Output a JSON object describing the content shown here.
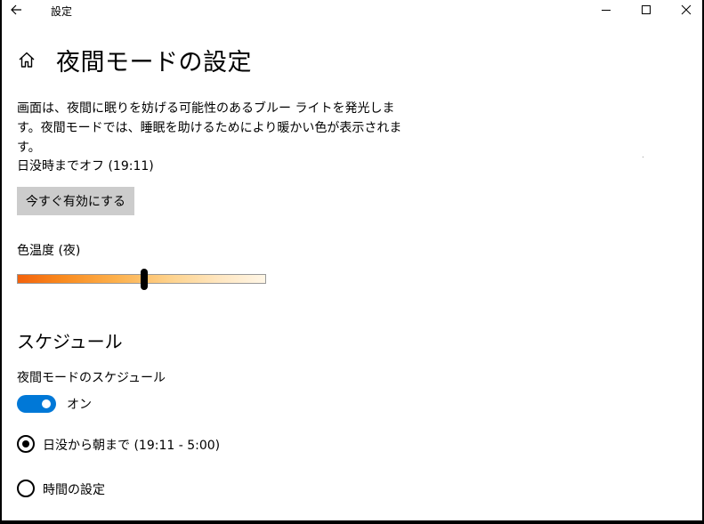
{
  "window": {
    "title": "設定",
    "controls": {
      "minimize": "minimize-icon",
      "maximize": "maximize-icon",
      "close": "close-icon"
    }
  },
  "header": {
    "back_icon": "back-arrow-icon",
    "home_icon": "home-icon",
    "title": "夜間モードの設定"
  },
  "description": "画面は、夜間に眠りを妨げる可能性のあるブルー ライトを発光します。夜間モードでは、睡眠を助けるためにより暖かい色が表示されます。",
  "status": "日没時までオフ (19:11)",
  "enable_button": "今すぐ有効にする",
  "color_temperature": {
    "label": "色温度 (夜)",
    "value_fraction": 0.51
  },
  "schedule": {
    "heading": "スケジュール",
    "toggle_label": "夜間モードのスケジュール",
    "toggle_state": "オン",
    "toggle_on": true,
    "options": [
      {
        "label": "日没から朝まで (19:11 - 5:00)",
        "selected": true
      },
      {
        "label": "時間の設定",
        "selected": false
      }
    ]
  },
  "colors": {
    "accent": "#0078d7",
    "button_bg": "#cccccc"
  }
}
